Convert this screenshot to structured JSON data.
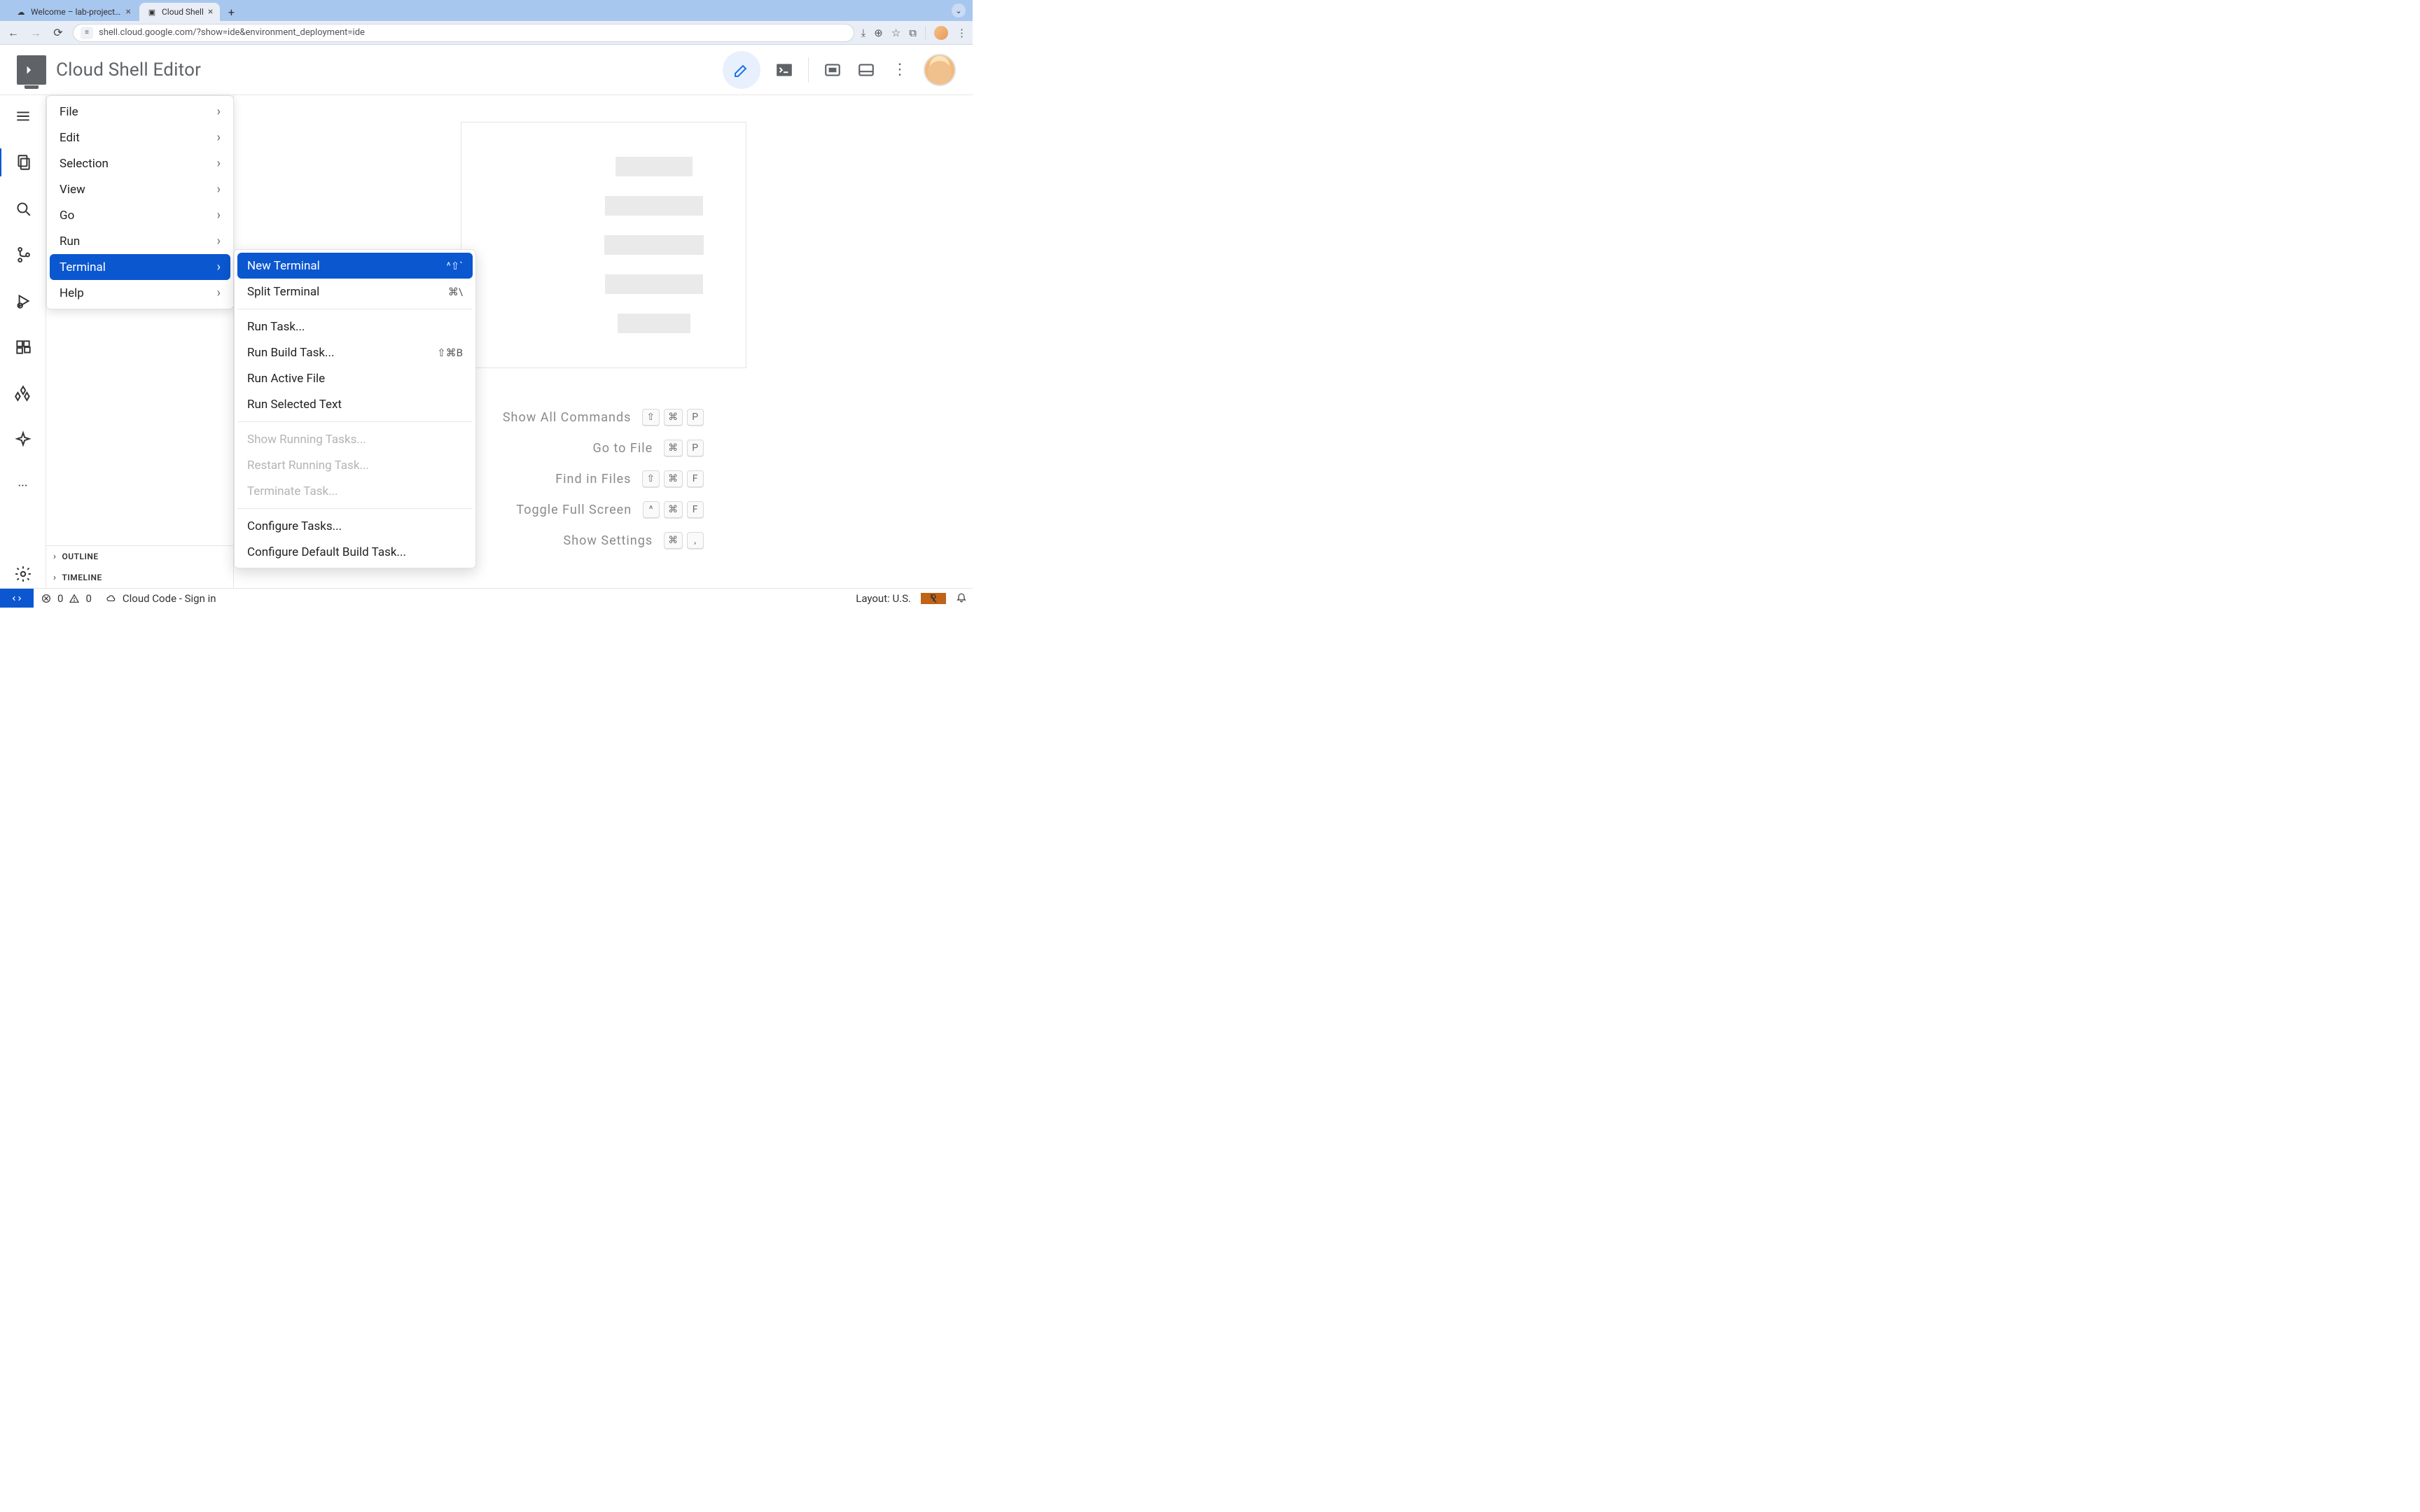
{
  "browser": {
    "tabs": [
      {
        "title": "Welcome – lab-project-id-ex"
      },
      {
        "title": "Cloud Shell"
      }
    ],
    "url": "shell.cloud.google.com/?show=ide&environment_deployment=ide"
  },
  "header": {
    "title": "Cloud Shell Editor"
  },
  "menubar": {
    "items": [
      {
        "label": "File"
      },
      {
        "label": "Edit"
      },
      {
        "label": "Selection"
      },
      {
        "label": "View"
      },
      {
        "label": "Go"
      },
      {
        "label": "Run"
      },
      {
        "label": "Terminal",
        "selected": true
      },
      {
        "label": "Help"
      }
    ]
  },
  "terminal_submenu": {
    "groups": [
      [
        {
          "label": "New Terminal",
          "shortcut": "^⇧`",
          "selected": true
        },
        {
          "label": "Split Terminal",
          "shortcut": "⌘\\"
        }
      ],
      [
        {
          "label": "Run Task..."
        },
        {
          "label": "Run Build Task...",
          "shortcut": "⇧⌘B"
        },
        {
          "label": "Run Active File"
        },
        {
          "label": "Run Selected Text"
        }
      ],
      [
        {
          "label": "Show Running Tasks...",
          "disabled": true
        },
        {
          "label": "Restart Running Task...",
          "disabled": true
        },
        {
          "label": "Terminate Task...",
          "disabled": true
        }
      ],
      [
        {
          "label": "Configure Tasks..."
        },
        {
          "label": "Configure Default Build Task..."
        }
      ]
    ]
  },
  "hints": [
    {
      "label": "Show All Commands",
      "keys": [
        "⇧",
        "⌘",
        "P"
      ]
    },
    {
      "label": "Go to File",
      "keys": [
        "⌘",
        "P"
      ]
    },
    {
      "label": "Find in Files",
      "keys": [
        "⇧",
        "⌘",
        "F"
      ]
    },
    {
      "label": "Toggle Full Screen",
      "keys": [
        "^",
        "⌘",
        "F"
      ]
    },
    {
      "label": "Show Settings",
      "keys": [
        "⌘",
        ","
      ]
    }
  ],
  "sidepanel": {
    "outline": "OUTLINE",
    "timeline": "TIMELINE"
  },
  "statusbar": {
    "errors": "0",
    "warnings": "0",
    "cloudcode": "Cloud Code - Sign in",
    "layout": "Layout: U.S."
  }
}
